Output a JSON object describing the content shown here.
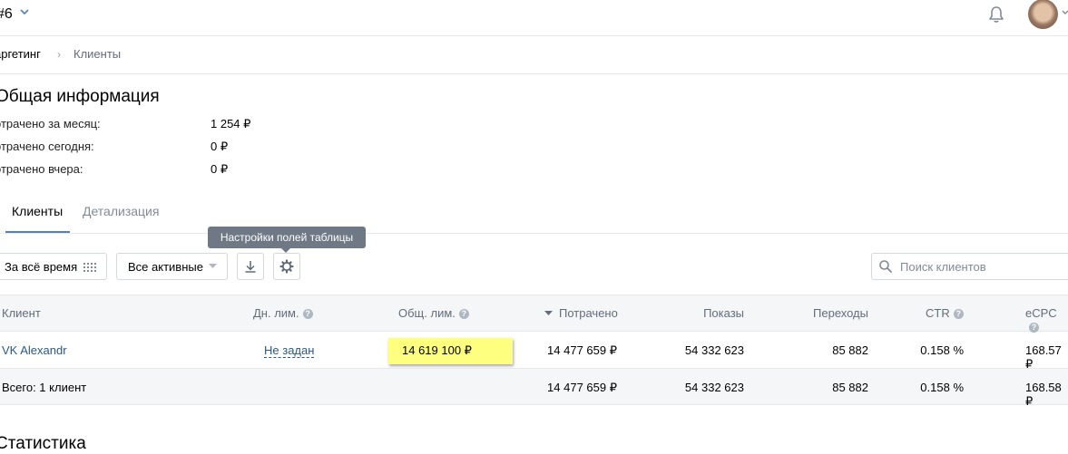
{
  "header": {
    "account": "#6",
    "icons": {
      "account_menu": "chevron-down-icon",
      "notifications": "bell-icon",
      "avatar": "user-avatar"
    }
  },
  "breadcrumb": {
    "root": "аргетинг",
    "separator": "›",
    "current": "Клиенты"
  },
  "general_info": {
    "title": "Общая информация",
    "rows": [
      {
        "label": "отрачено за месяц:",
        "value": "1 254 ₽"
      },
      {
        "label": "отрачено сегодня:",
        "value": "0 ₽"
      },
      {
        "label": "отрачено вчера:",
        "value": "0 ₽"
      }
    ]
  },
  "tabs": [
    {
      "label": "Клиенты",
      "active": true
    },
    {
      "label": "Детализация",
      "active": false
    }
  ],
  "tooltip": "Настройки полей таблицы",
  "toolbar": {
    "period": "За всё время",
    "filter": "Все активные",
    "search_placeholder": "Поиск клиентов",
    "search_value": ""
  },
  "table": {
    "columns": {
      "client": "Клиент",
      "daily_limit": "Дн. лим.",
      "total_limit": "Общ. лим.",
      "spent": "Потрачено",
      "impressions": "Показы",
      "clicks": "Переходы",
      "ctr": "CTR",
      "ecpc": "eCPC"
    },
    "rows": [
      {
        "client": "VK Alexandr",
        "daily_limit": "Не задан",
        "total_limit": "14 619 100 ₽",
        "spent": "14 477 659 ₽",
        "impressions": "54 332 623",
        "clicks": "85 882",
        "ctr": "0.158 %",
        "ecpc": "168.57 ₽"
      }
    ],
    "total": {
      "label": "Всего: 1 клиент",
      "spent": "14 477 659 ₽",
      "impressions": "54 332 623",
      "clicks": "85 882",
      "ctr": "0.158 %",
      "ecpc": "168.58 ₽"
    }
  },
  "statistics": {
    "title": "Статистика"
  },
  "colors": {
    "link": "#2a5885",
    "accent": "#5181b8",
    "highlight": "#ffff7f",
    "tooltip_bg": "#6f7985"
  }
}
